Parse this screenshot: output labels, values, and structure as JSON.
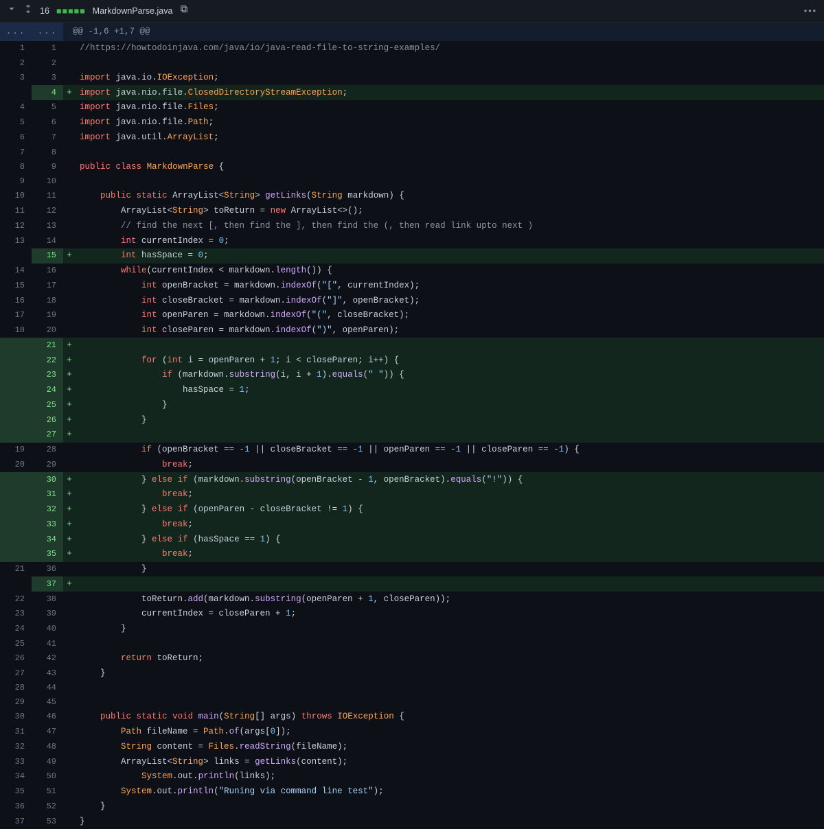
{
  "header": {
    "changeCount": "16",
    "additionsGraph": "■■■■■",
    "filename": "MarkdownParse.java",
    "kebab": "•••"
  },
  "hunk": {
    "text": "@@ -1,6 +1,7 @@",
    "expand": "..."
  },
  "lines": [
    {
      "old": "1",
      "new": "1",
      "mark": "",
      "type": "ctx",
      "code": "//https://howtodoinjava.com/java/io/java-read-file-to-string-examples/",
      "style": "com"
    },
    {
      "old": "2",
      "new": "2",
      "mark": "",
      "type": "ctx",
      "code": "",
      "style": "plain"
    },
    {
      "old": "3",
      "new": "3",
      "mark": "",
      "type": "ctx",
      "html": "<span class='k-red'>import</span> <span class='plain'>java</span>.<span class='plain'>io</span>.<span class='ty'>IOException</span>;"
    },
    {
      "old": "",
      "new": "4",
      "mark": "+",
      "type": "add",
      "html": "<span class='k-red'>import</span> <span class='plain'>java</span>.<span class='plain'>nio</span>.<span class='plain'>file</span>.<span class='ty'>ClosedDirectoryStreamException</span>;"
    },
    {
      "old": "4",
      "new": "5",
      "mark": "",
      "type": "ctx",
      "html": "<span class='k-red'>import</span> <span class='plain'>java</span>.<span class='plain'>nio</span>.<span class='plain'>file</span>.<span class='ty'>Files</span>;"
    },
    {
      "old": "5",
      "new": "6",
      "mark": "",
      "type": "ctx",
      "html": "<span class='k-red'>import</span> <span class='plain'>java</span>.<span class='plain'>nio</span>.<span class='plain'>file</span>.<span class='ty'>Path</span>;"
    },
    {
      "old": "6",
      "new": "7",
      "mark": "",
      "type": "ctx",
      "html": "<span class='k-red'>import</span> <span class='plain'>java</span>.<span class='plain'>util</span>.<span class='ty'>ArrayList</span>;"
    },
    {
      "old": "7",
      "new": "8",
      "mark": "",
      "type": "ctx",
      "code": "",
      "style": "plain"
    },
    {
      "old": "8",
      "new": "9",
      "mark": "",
      "type": "ctx",
      "html": "<span class='k-red'>public</span> <span class='k-red'>class</span> <span class='ty'>MarkdownParse</span> {"
    },
    {
      "old": "9",
      "new": "10",
      "mark": "",
      "type": "ctx",
      "code": "",
      "style": "plain"
    },
    {
      "old": "10",
      "new": "11",
      "mark": "",
      "type": "ctx",
      "html": "    <span class='k-red'>public</span> <span class='k-red'>static</span> <span class='plain'>ArrayList</span>&lt;<span class='ty'>String</span>&gt; <span class='k-purple'>getLinks</span>(<span class='ty'>String</span> <span class='plain'>markdown</span>) {"
    },
    {
      "old": "11",
      "new": "12",
      "mark": "",
      "type": "ctx",
      "html": "        <span class='plain'>ArrayList</span>&lt;<span class='ty'>String</span>&gt; toReturn = <span class='k-red'>new</span> <span class='plain'>ArrayList</span>&lt;&gt;();"
    },
    {
      "old": "12",
      "new": "13",
      "mark": "",
      "type": "ctx",
      "html": "        <span class='com'>// find the next [, then find the ], then find the (, then read link upto next )</span>"
    },
    {
      "old": "13",
      "new": "14",
      "mark": "",
      "type": "ctx",
      "html": "        <span class='k-red'>int</span> currentIndex = <span class='num'>0</span>;"
    },
    {
      "old": "",
      "new": "15",
      "mark": "+",
      "type": "add",
      "html": "        <span class='k-red'>int</span> hasSpace = <span class='num'>0</span>;"
    },
    {
      "old": "14",
      "new": "16",
      "mark": "",
      "type": "ctx",
      "html": "        <span class='k-red'>while</span>(currentIndex &lt; markdown.<span class='k-purple'>length</span>()) {"
    },
    {
      "old": "15",
      "new": "17",
      "mark": "",
      "type": "ctx",
      "html": "            <span class='k-red'>int</span> openBracket = markdown.<span class='k-purple'>indexOf</span>(<span class='str'>\"[\"</span>, currentIndex);"
    },
    {
      "old": "16",
      "new": "18",
      "mark": "",
      "type": "ctx",
      "html": "            <span class='k-red'>int</span> closeBracket = markdown.<span class='k-purple'>indexOf</span>(<span class='str'>\"]\"</span>, openBracket);"
    },
    {
      "old": "17",
      "new": "19",
      "mark": "",
      "type": "ctx",
      "html": "            <span class='k-red'>int</span> openParen = markdown.<span class='k-purple'>indexOf</span>(<span class='str'>\"(\"</span>, closeBracket);"
    },
    {
      "old": "18",
      "new": "20",
      "mark": "",
      "type": "ctx",
      "html": "            <span class='k-red'>int</span> closeParen = markdown.<span class='k-purple'>indexOf</span>(<span class='str'>\")\"</span>, openParen);"
    },
    {
      "old": "",
      "new": "21",
      "mark": "+",
      "type": "add-block",
      "code": "",
      "style": "plain"
    },
    {
      "old": "",
      "new": "22",
      "mark": "+",
      "type": "add-block",
      "html": "            <span class='k-red'>for</span> (<span class='k-red'>int</span> i = openParen + <span class='num'>1</span>; i &lt; closeParen; i++) {"
    },
    {
      "old": "",
      "new": "23",
      "mark": "+",
      "type": "add-block",
      "html": "                <span class='k-red'>if</span> (markdown.<span class='k-purple'>substring</span>(i, i + <span class='num'>1</span>).<span class='k-purple'>equals</span>(<span class='str'>\" \"</span>)) {"
    },
    {
      "old": "",
      "new": "24",
      "mark": "+",
      "type": "add-block",
      "html": "                    hasSpace = <span class='num'>1</span>;"
    },
    {
      "old": "",
      "new": "25",
      "mark": "+",
      "type": "add-block",
      "html": "                }"
    },
    {
      "old": "",
      "new": "26",
      "mark": "+",
      "type": "add-block",
      "html": "            }"
    },
    {
      "old": "",
      "new": "27",
      "mark": "+",
      "type": "add-block",
      "code": "",
      "style": "plain"
    },
    {
      "old": "19",
      "new": "28",
      "mark": "",
      "type": "ctx",
      "html": "            <span class='k-red'>if</span> (openBracket == -<span class='num'>1</span> || closeBracket == -<span class='num'>1</span> || openParen == -<span class='num'>1</span> || closeParen == -<span class='num'>1</span>) {"
    },
    {
      "old": "20",
      "new": "29",
      "mark": "",
      "type": "ctx",
      "html": "                <span class='k-red'>break</span>;"
    },
    {
      "old": "",
      "new": "30",
      "mark": "+",
      "type": "add-block",
      "html": "            } <span class='k-red'>else</span> <span class='k-red'>if</span> (markdown.<span class='k-purple'>substring</span>(openBracket - <span class='num'>1</span>, openBracket).<span class='k-purple'>equals</span>(<span class='str'>\"!\"</span>)) {"
    },
    {
      "old": "",
      "new": "31",
      "mark": "+",
      "type": "add-block",
      "html": "                <span class='k-red'>break</span>;"
    },
    {
      "old": "",
      "new": "32",
      "mark": "+",
      "type": "add-block",
      "html": "            } <span class='k-red'>else</span> <span class='k-red'>if</span> (openParen - closeBracket != <span class='num'>1</span>) {"
    },
    {
      "old": "",
      "new": "33",
      "mark": "+",
      "type": "add-block",
      "html": "                <span class='k-red'>break</span>;"
    },
    {
      "old": "",
      "new": "34",
      "mark": "+",
      "type": "add-block",
      "html": "            } <span class='k-red'>else</span> <span class='k-red'>if</span> (hasSpace == <span class='num'>1</span>) {"
    },
    {
      "old": "",
      "new": "35",
      "mark": "+",
      "type": "add-block",
      "html": "                <span class='k-red'>break</span>;"
    },
    {
      "old": "21",
      "new": "36",
      "mark": "",
      "type": "ctx",
      "html": "            }"
    },
    {
      "old": "",
      "new": "37",
      "mark": "+",
      "type": "add",
      "code": "",
      "style": "plain"
    },
    {
      "old": "22",
      "new": "38",
      "mark": "",
      "type": "ctx",
      "html": "            toReturn.<span class='k-purple'>add</span>(markdown.<span class='k-purple'>substring</span>(openParen + <span class='num'>1</span>, closeParen));"
    },
    {
      "old": "23",
      "new": "39",
      "mark": "",
      "type": "ctx",
      "html": "            currentIndex = closeParen + <span class='num'>1</span>;"
    },
    {
      "old": "24",
      "new": "40",
      "mark": "",
      "type": "ctx",
      "html": "        }"
    },
    {
      "old": "25",
      "new": "41",
      "mark": "",
      "type": "ctx",
      "code": "",
      "style": "plain"
    },
    {
      "old": "26",
      "new": "42",
      "mark": "",
      "type": "ctx",
      "html": "        <span class='k-red'>return</span> toReturn;"
    },
    {
      "old": "27",
      "new": "43",
      "mark": "",
      "type": "ctx",
      "html": "    }"
    },
    {
      "old": "28",
      "new": "44",
      "mark": "",
      "type": "ctx",
      "code": "",
      "style": "plain"
    },
    {
      "old": "29",
      "new": "45",
      "mark": "",
      "type": "ctx",
      "code": "",
      "style": "plain"
    },
    {
      "old": "30",
      "new": "46",
      "mark": "",
      "type": "ctx",
      "html": "    <span class='k-red'>public</span> <span class='k-red'>static</span> <span class='k-red'>void</span> <span class='k-purple'>main</span>(<span class='ty'>String</span>[] <span class='plain'>args</span>) <span class='k-red'>throws</span> <span class='ty'>IOException</span> {"
    },
    {
      "old": "31",
      "new": "47",
      "mark": "",
      "type": "ctx",
      "html": "        <span class='ty'>Path</span> fileName = <span class='ty'>Path</span>.<span class='k-purple'>of</span>(args[<span class='num'>0</span>]);"
    },
    {
      "old": "32",
      "new": "48",
      "mark": "",
      "type": "ctx",
      "html": "        <span class='ty'>String</span> content = <span class='ty'>Files</span>.<span class='k-purple'>readString</span>(fileName);"
    },
    {
      "old": "33",
      "new": "49",
      "mark": "",
      "type": "ctx",
      "html": "        <span class='plain'>ArrayList</span>&lt;<span class='ty'>String</span>&gt; links = <span class='k-purple'>getLinks</span>(content);"
    },
    {
      "old": "34",
      "new": "50",
      "mark": "",
      "type": "ctx",
      "html": "\t    <span class='ty'>System</span>.out.<span class='k-purple'>println</span>(links);"
    },
    {
      "old": "35",
      "new": "51",
      "mark": "",
      "type": "ctx",
      "html": "        <span class='ty'>System</span>.out.<span class='k-purple'>println</span>(<span class='str'>\"Runing via command line test\"</span>);"
    },
    {
      "old": "36",
      "new": "52",
      "mark": "",
      "type": "ctx",
      "html": "    }"
    },
    {
      "old": "37",
      "new": "53",
      "mark": "",
      "type": "ctx",
      "html": "}"
    }
  ]
}
